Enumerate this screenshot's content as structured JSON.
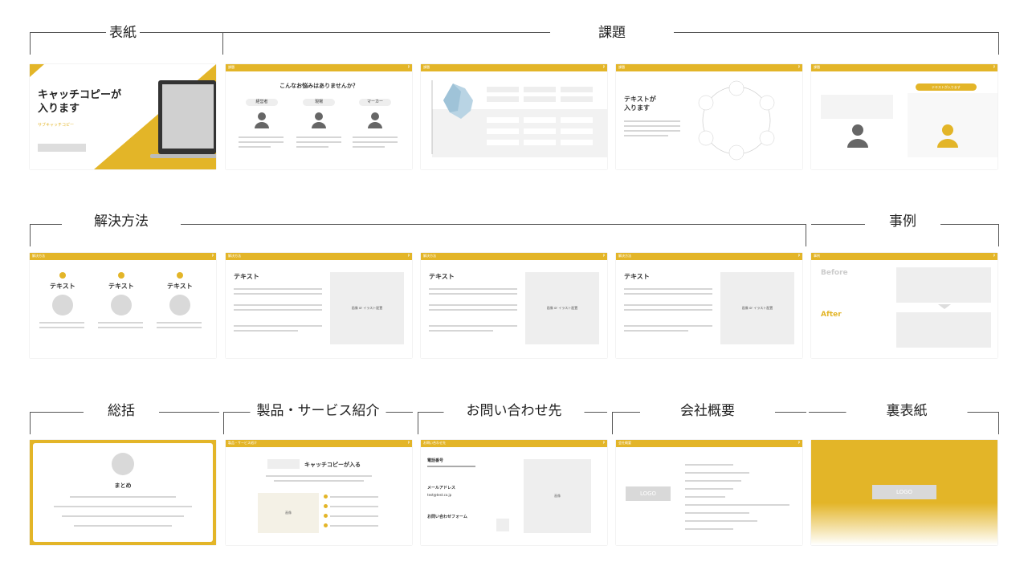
{
  "sections": {
    "cover": "表紙",
    "problem": "課題",
    "solution": "解決方法",
    "case": "事例",
    "summary": "総括",
    "product": "製品・サービス紹介",
    "contact": "お問い合わせ先",
    "company": "会社概要",
    "back": "裏表紙"
  },
  "cover": {
    "catchcopy": "キャッチコピーが\n入ります",
    "sub": "サブキャッチコピー"
  },
  "slide2": {
    "question": "こんなお悩みはありませんか？",
    "roles": [
      "経営者",
      "現場",
      "マーカー"
    ]
  },
  "slide4": {
    "title": "テキストが\n入ります"
  },
  "slide5": {
    "pill": "テキストが入ります"
  },
  "solution1": {
    "items": [
      "テキスト",
      "テキスト",
      "テキスト"
    ]
  },
  "solution_detail": {
    "title": "テキスト",
    "image": "画像 or イラスト配置"
  },
  "case": {
    "before": "Before",
    "after": "After"
  },
  "summary": {
    "title": "まとめ"
  },
  "product": {
    "catch": "キャッチコピーが入る",
    "image": "画像"
  },
  "contact": {
    "tel_label": "電話番号",
    "mail_label": "メールアドレス",
    "mail": "test@test.co.jp",
    "form_label": "お問い合わせフォーム",
    "image": "画像"
  },
  "company": {
    "logo": "LOGO"
  },
  "back": {
    "logo": "LOGO"
  },
  "colors": {
    "accent": "#e3b528",
    "gray": "#d9d9d9"
  }
}
